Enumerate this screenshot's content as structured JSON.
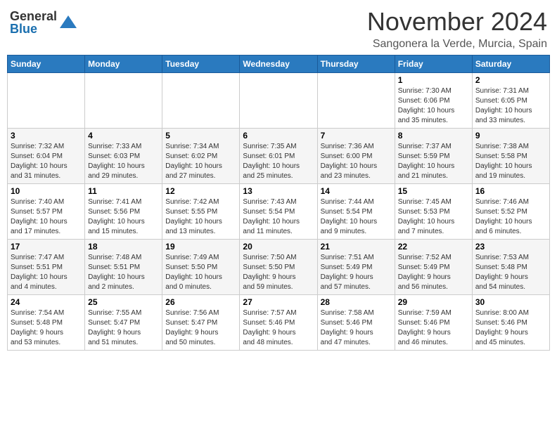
{
  "logo": {
    "general": "General",
    "blue": "Blue"
  },
  "header": {
    "month": "November 2024",
    "location": "Sangonera la Verde, Murcia, Spain"
  },
  "weekdays": [
    "Sunday",
    "Monday",
    "Tuesday",
    "Wednesday",
    "Thursday",
    "Friday",
    "Saturday"
  ],
  "weeks": [
    [
      {
        "day": "",
        "info": ""
      },
      {
        "day": "",
        "info": ""
      },
      {
        "day": "",
        "info": ""
      },
      {
        "day": "",
        "info": ""
      },
      {
        "day": "",
        "info": ""
      },
      {
        "day": "1",
        "info": "Sunrise: 7:30 AM\nSunset: 6:06 PM\nDaylight: 10 hours\nand 35 minutes."
      },
      {
        "day": "2",
        "info": "Sunrise: 7:31 AM\nSunset: 6:05 PM\nDaylight: 10 hours\nand 33 minutes."
      }
    ],
    [
      {
        "day": "3",
        "info": "Sunrise: 7:32 AM\nSunset: 6:04 PM\nDaylight: 10 hours\nand 31 minutes."
      },
      {
        "day": "4",
        "info": "Sunrise: 7:33 AM\nSunset: 6:03 PM\nDaylight: 10 hours\nand 29 minutes."
      },
      {
        "day": "5",
        "info": "Sunrise: 7:34 AM\nSunset: 6:02 PM\nDaylight: 10 hours\nand 27 minutes."
      },
      {
        "day": "6",
        "info": "Sunrise: 7:35 AM\nSunset: 6:01 PM\nDaylight: 10 hours\nand 25 minutes."
      },
      {
        "day": "7",
        "info": "Sunrise: 7:36 AM\nSunset: 6:00 PM\nDaylight: 10 hours\nand 23 minutes."
      },
      {
        "day": "8",
        "info": "Sunrise: 7:37 AM\nSunset: 5:59 PM\nDaylight: 10 hours\nand 21 minutes."
      },
      {
        "day": "9",
        "info": "Sunrise: 7:38 AM\nSunset: 5:58 PM\nDaylight: 10 hours\nand 19 minutes."
      }
    ],
    [
      {
        "day": "10",
        "info": "Sunrise: 7:40 AM\nSunset: 5:57 PM\nDaylight: 10 hours\nand 17 minutes."
      },
      {
        "day": "11",
        "info": "Sunrise: 7:41 AM\nSunset: 5:56 PM\nDaylight: 10 hours\nand 15 minutes."
      },
      {
        "day": "12",
        "info": "Sunrise: 7:42 AM\nSunset: 5:55 PM\nDaylight: 10 hours\nand 13 minutes."
      },
      {
        "day": "13",
        "info": "Sunrise: 7:43 AM\nSunset: 5:54 PM\nDaylight: 10 hours\nand 11 minutes."
      },
      {
        "day": "14",
        "info": "Sunrise: 7:44 AM\nSunset: 5:54 PM\nDaylight: 10 hours\nand 9 minutes."
      },
      {
        "day": "15",
        "info": "Sunrise: 7:45 AM\nSunset: 5:53 PM\nDaylight: 10 hours\nand 7 minutes."
      },
      {
        "day": "16",
        "info": "Sunrise: 7:46 AM\nSunset: 5:52 PM\nDaylight: 10 hours\nand 6 minutes."
      }
    ],
    [
      {
        "day": "17",
        "info": "Sunrise: 7:47 AM\nSunset: 5:51 PM\nDaylight: 10 hours\nand 4 minutes."
      },
      {
        "day": "18",
        "info": "Sunrise: 7:48 AM\nSunset: 5:51 PM\nDaylight: 10 hours\nand 2 minutes."
      },
      {
        "day": "19",
        "info": "Sunrise: 7:49 AM\nSunset: 5:50 PM\nDaylight: 10 hours\nand 0 minutes."
      },
      {
        "day": "20",
        "info": "Sunrise: 7:50 AM\nSunset: 5:50 PM\nDaylight: 9 hours\nand 59 minutes."
      },
      {
        "day": "21",
        "info": "Sunrise: 7:51 AM\nSunset: 5:49 PM\nDaylight: 9 hours\nand 57 minutes."
      },
      {
        "day": "22",
        "info": "Sunrise: 7:52 AM\nSunset: 5:49 PM\nDaylight: 9 hours\nand 56 minutes."
      },
      {
        "day": "23",
        "info": "Sunrise: 7:53 AM\nSunset: 5:48 PM\nDaylight: 9 hours\nand 54 minutes."
      }
    ],
    [
      {
        "day": "24",
        "info": "Sunrise: 7:54 AM\nSunset: 5:48 PM\nDaylight: 9 hours\nand 53 minutes."
      },
      {
        "day": "25",
        "info": "Sunrise: 7:55 AM\nSunset: 5:47 PM\nDaylight: 9 hours\nand 51 minutes."
      },
      {
        "day": "26",
        "info": "Sunrise: 7:56 AM\nSunset: 5:47 PM\nDaylight: 9 hours\nand 50 minutes."
      },
      {
        "day": "27",
        "info": "Sunrise: 7:57 AM\nSunset: 5:46 PM\nDaylight: 9 hours\nand 48 minutes."
      },
      {
        "day": "28",
        "info": "Sunrise: 7:58 AM\nSunset: 5:46 PM\nDaylight: 9 hours\nand 47 minutes."
      },
      {
        "day": "29",
        "info": "Sunrise: 7:59 AM\nSunset: 5:46 PM\nDaylight: 9 hours\nand 46 minutes."
      },
      {
        "day": "30",
        "info": "Sunrise: 8:00 AM\nSunset: 5:46 PM\nDaylight: 9 hours\nand 45 minutes."
      }
    ]
  ]
}
